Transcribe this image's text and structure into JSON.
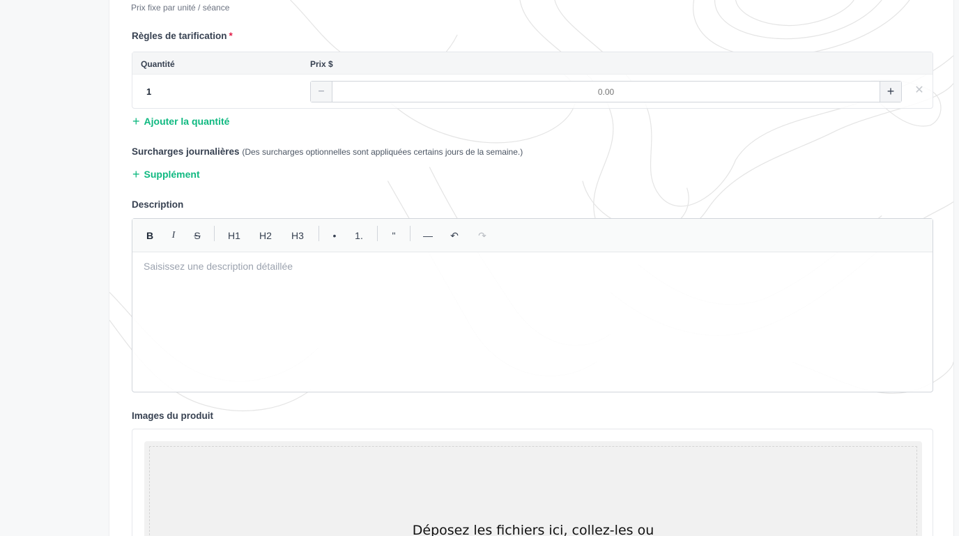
{
  "pricing": {
    "hint": "Prix fixe par unité / séance",
    "rules_label": "Règles de tarification",
    "required_mark": "*",
    "col_quantity": "Quantité",
    "col_price": "Prix $",
    "rows": [
      {
        "quantity": "1",
        "price_placeholder": "0.00"
      }
    ],
    "add_quantity_label": "Ajouter la quantité"
  },
  "surcharges": {
    "title": "Surcharges journalières",
    "note": "(Des surcharges optionnelles sont appliquées certains jours de la semaine.)",
    "add_label": "Supplément"
  },
  "description": {
    "label": "Description",
    "placeholder": "Saisissez une description détaillée",
    "toolbar": {
      "bold": "B",
      "italic": "I",
      "strike": "S",
      "h1": "H1",
      "h2": "H2",
      "h3": "H3",
      "bullet": "•",
      "ordered": "1.",
      "quote": "\"",
      "rule": "—",
      "undo": "↶",
      "redo": "↷"
    }
  },
  "images": {
    "label": "Images du produit",
    "dropzone_text": "Déposez les fichiers ici, collez-les ou"
  },
  "colors": {
    "accent": "#10b981",
    "required": "#e11d48"
  }
}
